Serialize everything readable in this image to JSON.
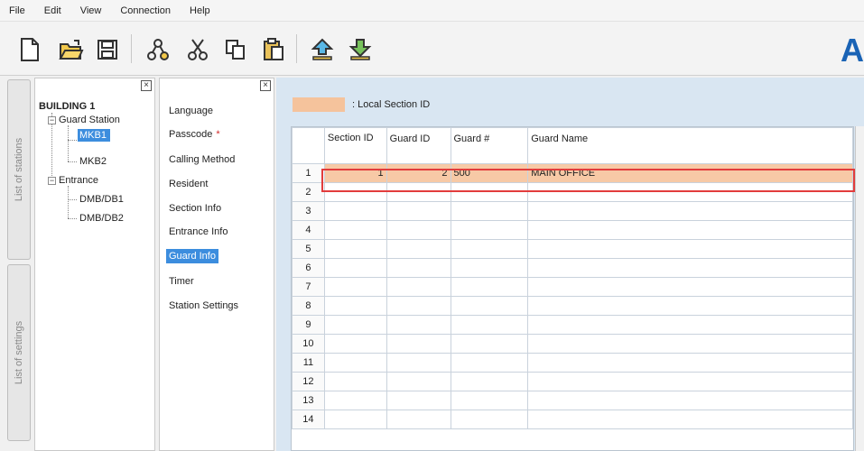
{
  "menu": [
    "File",
    "Edit",
    "View",
    "Connection",
    "Help"
  ],
  "toolbar_icons": [
    "new-file-icon",
    "open-folder-icon",
    "save-icon",
    "connect-icon",
    "cut-icon",
    "copy-icon",
    "paste-icon",
    "upload-icon",
    "download-icon"
  ],
  "brand_letter": "A",
  "side_tabs": {
    "stations": "List of stations",
    "settings": "List of settings"
  },
  "tree": {
    "root": "BUILDING 1",
    "guard_station": "Guard Station",
    "mkb1": "MKB1",
    "mkb2": "MKB2",
    "entrance": "Entrance",
    "dmb1": "DMB/DB1",
    "dmb2": "DMB/DB2",
    "close": "×"
  },
  "settings": {
    "close": "×",
    "items": [
      "Language",
      "Passcode",
      "Calling Method",
      "Resident",
      "Section Info",
      "Entrance Info",
      "Guard Info",
      "Timer",
      "Station Settings"
    ],
    "required_marker": "*",
    "active_index": 6
  },
  "legend": {
    "label": ": Local Section ID",
    "color": "#f5c39c"
  },
  "table": {
    "headers": [
      "Section ID",
      "Guard ID",
      "Guard #",
      "Guard Name"
    ],
    "row_numbers": [
      "1",
      "2",
      "3",
      "4",
      "5",
      "6",
      "7",
      "8",
      "9",
      "10",
      "11",
      "12",
      "13",
      "14"
    ],
    "row1": {
      "section_id": "1",
      "guard_id": "2",
      "guard_no": "500",
      "guard_name": "MAIN OFFICE"
    }
  },
  "colors": {
    "selection": "#3c8dde",
    "highlight_row": "#f7c9a6",
    "outline": "#e23c3c",
    "panel_bg": "#d9e6f2",
    "brand": "#1a63b5"
  }
}
